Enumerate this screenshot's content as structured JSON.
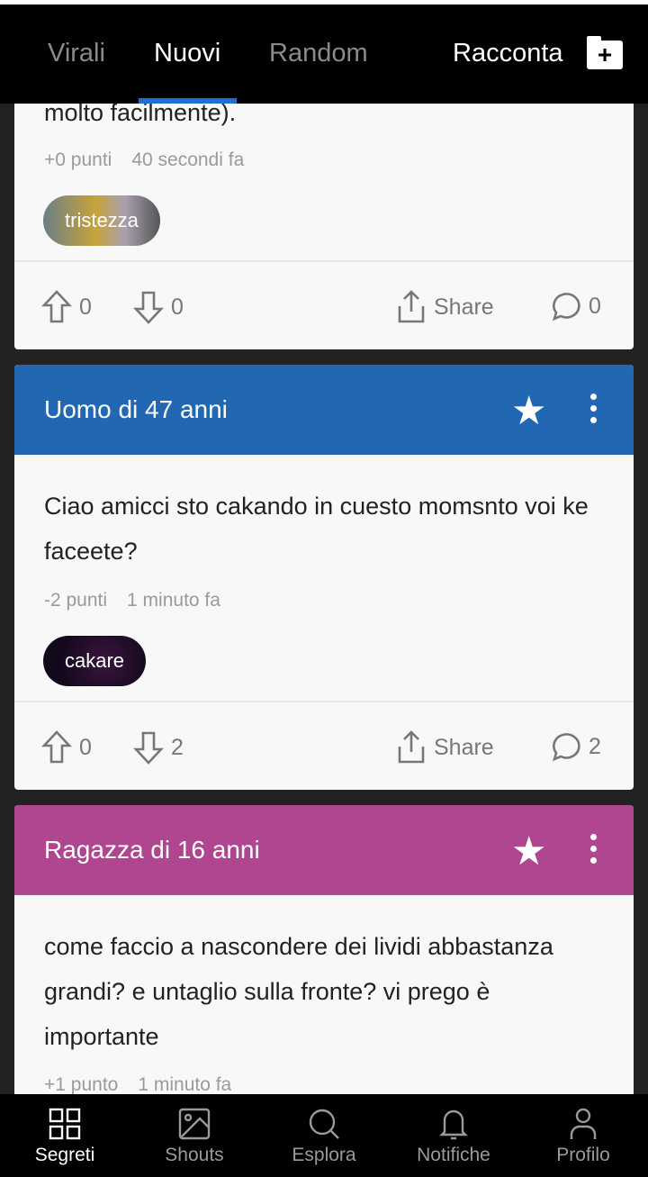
{
  "header": {
    "tabs": [
      {
        "label": "Virali"
      },
      {
        "label": "Nuovi",
        "active": true
      },
      {
        "label": "Random"
      }
    ],
    "racconta": "Racconta",
    "racconta_icon": "folder-plus-icon"
  },
  "posts": [
    {
      "body_tail": "molto facilmente).",
      "points": "+0 punti",
      "time": "40 secondi fa",
      "tag": "tristezza",
      "up": "0",
      "down": "0",
      "share": "Share",
      "comments": "0"
    },
    {
      "author": "Uomo di 47 anni",
      "color": "#2167b1",
      "body": "Ciao amicci sto cakando in cuesto momsnto voi ke faceete?",
      "points": "-2 punti",
      "time": "1 minuto fa",
      "tag": "cakare",
      "up": "0",
      "down": "2",
      "share": "Share",
      "comments": "2"
    },
    {
      "author": "Ragazza di 16 anni",
      "color": "#b0468f",
      "body": "come faccio a nascondere dei lividi abbastanza grandi? e untaglio sulla fronte? vi prego è importante",
      "points": "+1 punto",
      "time": "1 minuto fa"
    }
  ],
  "nav": [
    {
      "label": "Segreti",
      "icon": "grid-icon",
      "active": true
    },
    {
      "label": "Shouts",
      "icon": "image-icon"
    },
    {
      "label": "Esplora",
      "icon": "search-icon"
    },
    {
      "label": "Notifiche",
      "icon": "bell-icon"
    },
    {
      "label": "Profilo",
      "icon": "user-icon"
    }
  ]
}
